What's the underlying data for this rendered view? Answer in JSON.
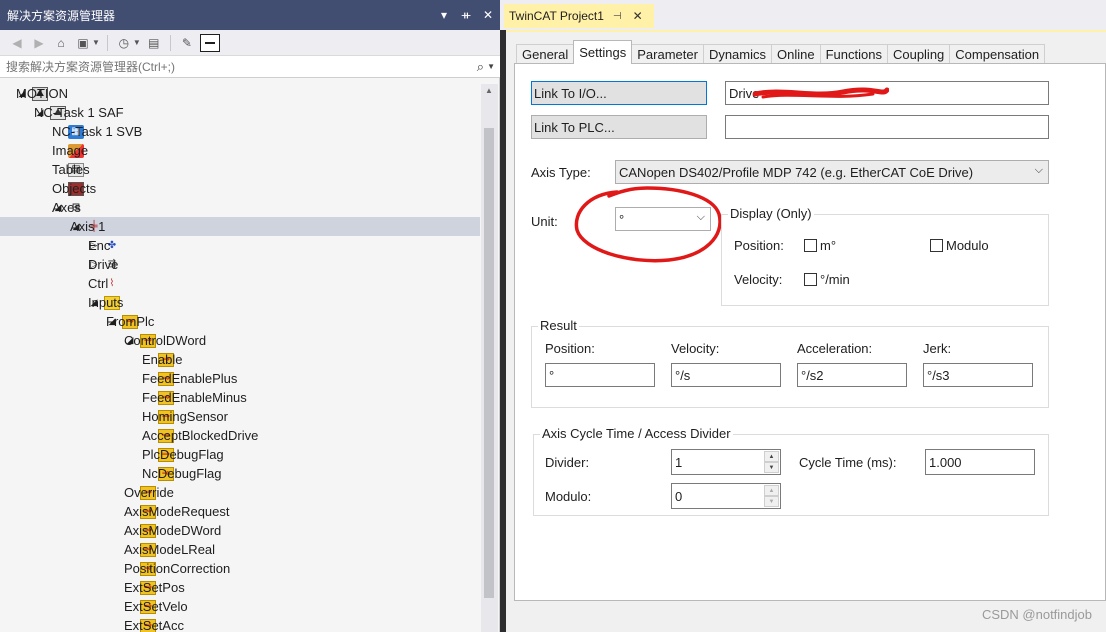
{
  "solution_explorer": {
    "title": "解决方案资源管理器",
    "title_controls": [
      "▾",
      "ᚑ",
      "✕"
    ],
    "search_placeholder": "搜索解决方案资源管理器(Ctrl+;)",
    "tree": [
      {
        "label": "MOTION",
        "depth": 1,
        "expander": "◢",
        "icon": "motion-icon"
      },
      {
        "label": "NC-Task 1 SAF",
        "depth": 2,
        "expander": "◢",
        "icon": "nc-task-icon"
      },
      {
        "label": "NC-Task 1 SVB",
        "depth": 3,
        "expander": "",
        "icon": "svb-icon"
      },
      {
        "label": "Image",
        "depth": 3,
        "expander": "",
        "icon": "image-icon"
      },
      {
        "label": "Tables",
        "depth": 3,
        "expander": "",
        "icon": "tables-icon"
      },
      {
        "label": "Objects",
        "depth": 3,
        "expander": "",
        "icon": "objects-icon"
      },
      {
        "label": "Axes",
        "depth": 3,
        "expander": "◢",
        "icon": "axes-icon"
      },
      {
        "label": "Axis 1",
        "depth": 4,
        "expander": "◢",
        "icon": "axis-icon",
        "selected": true
      },
      {
        "label": "Enc",
        "depth": 5,
        "expander": "▷",
        "icon": "encoder-icon"
      },
      {
        "label": "Drive",
        "depth": 5,
        "expander": "▷",
        "icon": "drive-icon"
      },
      {
        "label": "Ctrl",
        "depth": 5,
        "expander": "",
        "icon": "ctrl-icon"
      },
      {
        "label": "Inputs",
        "depth": 5,
        "expander": "◢",
        "icon": "folder-icon"
      },
      {
        "label": "FromPlc",
        "depth": 6,
        "expander": "◢",
        "icon": "variable-icon"
      },
      {
        "label": "ControlDWord",
        "depth": 7,
        "expander": "◢",
        "icon": "variable-icon"
      },
      {
        "label": "Enable",
        "depth": 8,
        "expander": "",
        "icon": "variable-icon"
      },
      {
        "label": "FeedEnablePlus",
        "depth": 8,
        "expander": "",
        "icon": "variable-icon"
      },
      {
        "label": "FeedEnableMinus",
        "depth": 8,
        "expander": "",
        "icon": "variable-icon"
      },
      {
        "label": "HomingSensor",
        "depth": 8,
        "expander": "",
        "icon": "variable-icon"
      },
      {
        "label": "AcceptBlockedDrive",
        "depth": 8,
        "expander": "",
        "icon": "variable-icon"
      },
      {
        "label": "PlcDebugFlag",
        "depth": 8,
        "expander": "",
        "icon": "variable-icon"
      },
      {
        "label": "NcDebugFlag",
        "depth": 8,
        "expander": "",
        "icon": "variable-icon"
      },
      {
        "label": "Override",
        "depth": 7,
        "expander": "",
        "icon": "variable-icon"
      },
      {
        "label": "AxisModeRequest",
        "depth": 7,
        "expander": "",
        "icon": "variable-icon"
      },
      {
        "label": "AxisModeDWord",
        "depth": 7,
        "expander": "",
        "icon": "variable-icon"
      },
      {
        "label": "AxisModeLReal",
        "depth": 7,
        "expander": "",
        "icon": "variable-icon"
      },
      {
        "label": "PositionCorrection",
        "depth": 7,
        "expander": "",
        "icon": "variable-icon"
      },
      {
        "label": "ExtSetPos",
        "depth": 7,
        "expander": "",
        "icon": "variable-icon"
      },
      {
        "label": "ExtSetVelo",
        "depth": 7,
        "expander": "",
        "icon": "variable-icon"
      },
      {
        "label": "ExtSetAcc",
        "depth": 7,
        "expander": "",
        "icon": "variable-icon"
      }
    ]
  },
  "document": {
    "tab_title": "TwinCAT Project1",
    "subtabs": [
      "General",
      "Settings",
      "Parameter",
      "Dynamics",
      "Online",
      "Functions",
      "Coupling",
      "Compensation"
    ],
    "active_subtab": "Settings",
    "link_io_label": "Link To I/O...",
    "link_io_value": "Drive",
    "link_plc_label": "Link To PLC...",
    "link_plc_value": "",
    "axis_type_label": "Axis Type:",
    "axis_type_value": "CANopen DS402/Profile MDP 742 (e.g. EtherCAT CoE Drive)",
    "unit_label": "Unit:",
    "unit_value": "°",
    "display_only": {
      "title": "Display (Only)",
      "position_label": "Position:",
      "position_option": "m°",
      "modulo_label": "Modulo",
      "velocity_label": "Velocity:",
      "velocity_option": "°/min"
    },
    "result": {
      "title": "Result",
      "position_label": "Position:",
      "position_value": "°",
      "velocity_label": "Velocity:",
      "velocity_value": "°/s",
      "acceleration_label": "Acceleration:",
      "acceleration_value": "°/s2",
      "jerk_label": "Jerk:",
      "jerk_value": "°/s3"
    },
    "cycle_time": {
      "title": "Axis Cycle Time / Access Divider",
      "divider_label": "Divider:",
      "divider_value": "1",
      "cycle_time_label": "Cycle Time (ms):",
      "cycle_time_value": "1.000",
      "modulo_label": "Modulo:",
      "modulo_value": "0"
    }
  },
  "watermark": "CSDN @notfindjob",
  "colors": {
    "title_bar": "#424d72",
    "doc_tab": "#fff1a8",
    "selected_row": "#cfd3de",
    "annotation_red": "#e01818"
  }
}
